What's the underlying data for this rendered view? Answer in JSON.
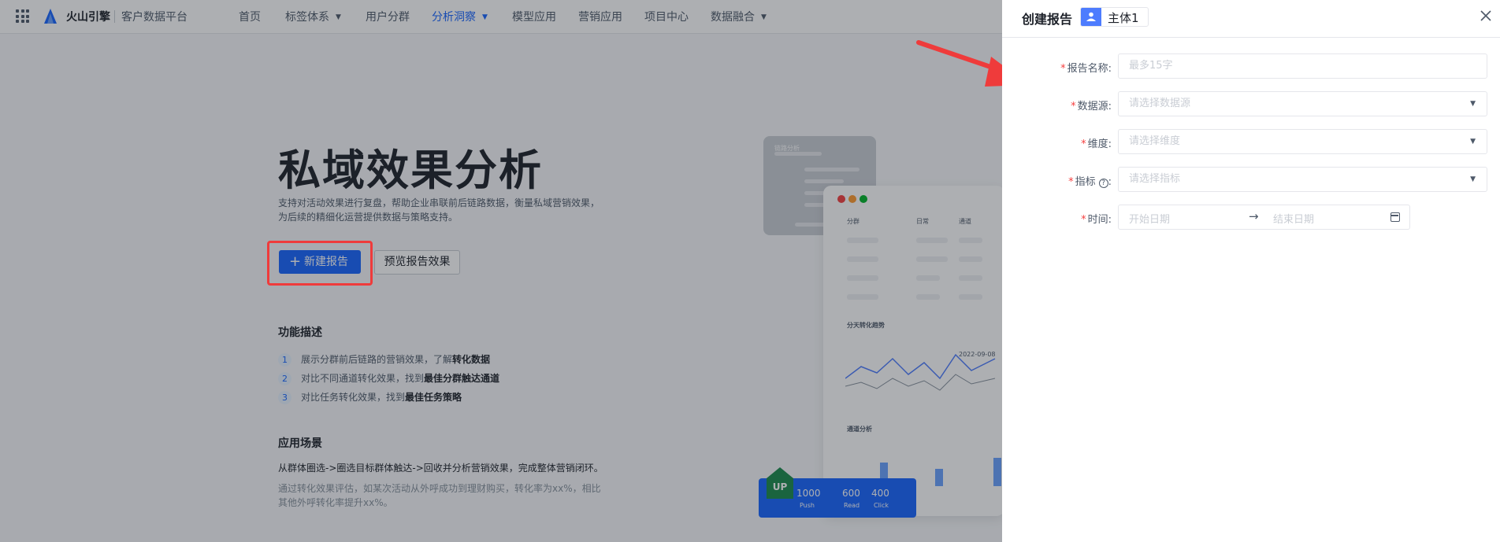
{
  "topbar": {
    "brand": "火山引擎",
    "product": "客户数据平台",
    "nav": [
      {
        "label": "首页",
        "active": false,
        "dropdown": false
      },
      {
        "label": "标签体系",
        "active": false,
        "dropdown": true
      },
      {
        "label": "用户分群",
        "active": false,
        "dropdown": false
      },
      {
        "label": "分析洞察",
        "active": true,
        "dropdown": true
      },
      {
        "label": "模型应用",
        "active": false,
        "dropdown": false
      },
      {
        "label": "营销应用",
        "active": false,
        "dropdown": false
      },
      {
        "label": "项目中心",
        "active": false,
        "dropdown": false
      },
      {
        "label": "数据融合",
        "active": false,
        "dropdown": true
      }
    ]
  },
  "page": {
    "title": "私域效果分析",
    "description_line1": "支持对活动效果进行复盘，帮助企业串联前后链路数据，衡量私域营销效果，",
    "description_line2": "为后续的精细化运营提供数据与策略支持。",
    "new_report_button": "新建报告",
    "preview_button": "预览报告效果",
    "features_title": "功能描述",
    "features": [
      {
        "num": "1",
        "text": "展示分群前后链路的营销效果，了解",
        "bold": "转化数据"
      },
      {
        "num": "2",
        "text": "对比不同通道转化效果，找到",
        "bold": "最佳分群触达通道"
      },
      {
        "num": "3",
        "text": "对比任务转化效果，找到",
        "bold": "最佳任务策略"
      }
    ],
    "scenario_title": "应用场景",
    "scenario_text": "从群体圈选->圈选目标群体触达->回收并分析营销效果，完成整体营销闭环。",
    "scenario_desc_line1": "通过转化效果评估，如某次活动从外呼成功到理财购买，转化率为xx%，相比",
    "scenario_desc_line2": "其他外呼转化率提升xx%。"
  },
  "illustration": {
    "card_title": "链路分析",
    "table_header": [
      "分群",
      "日常",
      "通道"
    ],
    "chart_title": "分天转化趋势",
    "chart_date": "2022-09-08",
    "channel_title": "通道分析",
    "up_label": "UP",
    "stats": [
      {
        "value": "1000",
        "label": "Push"
      },
      {
        "value": "600",
        "label": "Read"
      },
      {
        "value": "400",
        "label": "Click"
      }
    ]
  },
  "drawer": {
    "title": "创建报告",
    "subject_label": "主体1",
    "fields": {
      "report_name": {
        "label": "报告名称:",
        "placeholder": "最多15字"
      },
      "data_source": {
        "label": "数据源:",
        "placeholder": "请选择数据源"
      },
      "dimension": {
        "label": "维度:",
        "placeholder": "请选择维度"
      },
      "metric": {
        "label": "指标",
        "placeholder": "请选择指标"
      },
      "time": {
        "label": "时间:",
        "start_placeholder": "开始日期",
        "end_placeholder": "结束日期"
      }
    }
  },
  "colors": {
    "primary": "#1664ff",
    "highlight": "#ef3b3b",
    "required": "#f53f3f"
  }
}
